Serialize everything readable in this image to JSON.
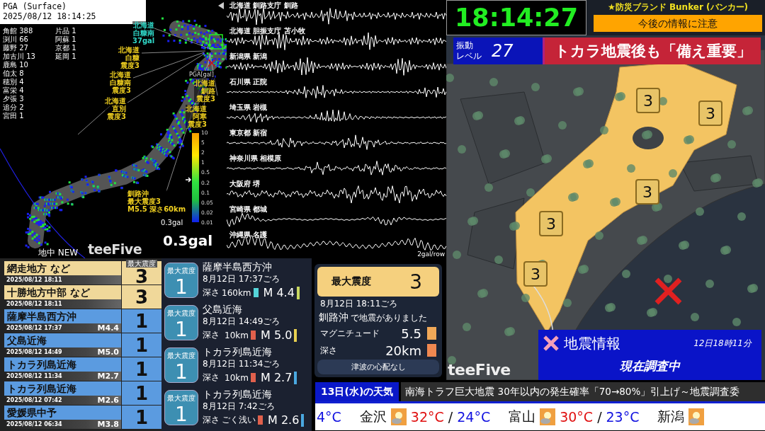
{
  "pga_map": {
    "title": "PGA (Surface)",
    "timestamp": "2025/08/12 18:14:25",
    "station_counts": [
      {
        "name": "角館",
        "count": "388"
      },
      {
        "name": "渕川",
        "count": "66"
      },
      {
        "name": "藤野",
        "count": "27"
      },
      {
        "name": "加古川",
        "count": "13"
      },
      {
        "name": "鹿島",
        "count": "10"
      },
      {
        "name": "伯太",
        "count": "8"
      },
      {
        "name": "穂別",
        "count": "4"
      },
      {
        "name": "富栄",
        "count": "4"
      },
      {
        "name": "夕張",
        "count": "3"
      },
      {
        "name": "追分",
        "count": "2"
      },
      {
        "name": "宮田",
        "count": "1"
      },
      {
        "name": "片品",
        "count": "1"
      },
      {
        "name": "阿蘇",
        "count": "1"
      },
      {
        "name": "京都",
        "count": "1"
      },
      {
        "name": "延岡",
        "count": "1"
      }
    ],
    "labels": [
      {
        "kind": "gal",
        "lines": [
          "北海道",
          "白糠南",
          "37gal"
        ]
      },
      {
        "kind": "intensity",
        "lines": [
          "北海道",
          "白糠",
          "震度3"
        ]
      },
      {
        "kind": "intensity",
        "lines": [
          "北海道",
          "白糠南",
          "震度3"
        ]
      },
      {
        "kind": "intensity",
        "lines": [
          "北海道",
          "直別",
          "震度3"
        ]
      },
      {
        "kind": "intensity",
        "lines": [
          "北海道",
          "釧路",
          "震度3"
        ]
      },
      {
        "kind": "intensity",
        "lines": [
          "北海道",
          "阿寒",
          "震度3"
        ]
      },
      {
        "kind": "epicenter",
        "lines": [
          "釧路沖",
          "最大震度3",
          "M5.5 深さ60km"
        ]
      }
    ],
    "scale": {
      "title": "PGA[gal]",
      "ticks": [
        "10",
        "5",
        "2",
        "1",
        "0.5",
        "0.2",
        "0.1",
        "0.05",
        "0.02",
        "0.01"
      ]
    },
    "current_small": "0.3gal",
    "current_large": "0.3gal",
    "sensor_label": "地中 NEW",
    "logo": "teeFive"
  },
  "waveforms": {
    "stations": [
      "北海道 釧路支庁 釧路",
      "北海道 胆振支庁 苫小牧",
      "新潟県 新潟",
      "石川県 正院",
      "埼玉県 岩槻",
      "東京都 新宿",
      "神奈川県 相模原",
      "大阪府 堺",
      "宮崎県 都城",
      "沖縄県 名護"
    ],
    "scale_label": "2gal/row"
  },
  "recent_list": {
    "intensity_header": "最大震度",
    "rows": [
      {
        "kind": "area",
        "region": "網走地方 など",
        "datetime": "2025/08/12 18:11",
        "intensity": "3"
      },
      {
        "kind": "area",
        "region": "十勝地方中部 など",
        "datetime": "2025/08/12 18:11",
        "intensity": "3"
      },
      {
        "kind": "epicenter",
        "region": "薩摩半島西方沖",
        "datetime": "2025/08/12 17:37",
        "magnitude": "M4.4",
        "intensity": "1"
      },
      {
        "kind": "epicenter",
        "region": "父島近海",
        "datetime": "2025/08/12 14:49",
        "magnitude": "M5.0",
        "intensity": "1"
      },
      {
        "kind": "epicenter",
        "region": "トカラ列島近海",
        "datetime": "2025/08/12 11:34",
        "magnitude": "M2.7",
        "intensity": "1"
      },
      {
        "kind": "epicenter",
        "region": "トカラ列島近海",
        "datetime": "2025/08/12 07:42",
        "magnitude": "M2.6",
        "intensity": "1"
      },
      {
        "kind": "epicenter",
        "region": "愛媛県中予",
        "datetime": "2025/08/12 06:34",
        "magnitude": "M3.8",
        "intensity": "1"
      }
    ]
  },
  "quake_cards": [
    {
      "badge": "最大震度",
      "intensity": "1",
      "place": "薩摩半島西方沖",
      "time": "8月12日 17:37ごろ",
      "depth_label": "深さ",
      "depth": {
        "text": "160km",
        "color": "#55d4d8"
      },
      "magnitude": {
        "text": "M 4.4",
        "color": "#c8d860"
      }
    },
    {
      "badge": "最大震度",
      "intensity": "1",
      "place": "父島近海",
      "time": "8月12日 14:49ごろ",
      "depth_label": "深さ",
      "depth": {
        "text": "10km",
        "color": "#e0604c"
      },
      "magnitude": {
        "text": "M 5.0",
        "color": "#e8d050"
      }
    },
    {
      "badge": "最大震度",
      "intensity": "1",
      "place": "トカラ列島近海",
      "time": "8月12日 11:34ごろ",
      "depth_label": "深さ",
      "depth": {
        "text": "10km",
        "color": "#e0604c"
      },
      "magnitude": {
        "text": "M 2.7",
        "color": "#4aa8e0"
      }
    },
    {
      "badge": "最大震度",
      "intensity": "1",
      "place": "トカラ列島近海",
      "time": "8月12日 7:42ごろ",
      "depth_label": "深さ",
      "depth": {
        "text": "ごく浅い",
        "color": "#e0604c"
      },
      "magnitude": {
        "text": "M 2.6",
        "color": "#4aa8e0"
      }
    }
  ],
  "summary": {
    "label": "最大震度",
    "intensity": "3",
    "time": "8月12日 18:11ごろ",
    "place": "釧路沖",
    "place_suffix": "で地震がありました",
    "rows": [
      {
        "label": "マグニチュード",
        "value": "5.5",
        "color": "#f0a858"
      },
      {
        "label": "深さ",
        "value": "20km",
        "color": "#f08850"
      }
    ],
    "tsunami": "津波の心配なし"
  },
  "clock": "18:14:27",
  "sponsor": "★防災ブランド Bunker (バンカー)",
  "alert": "今後の情報に注意",
  "vibration": {
    "label_lines": [
      "振動",
      "レベル"
    ],
    "value": "27"
  },
  "headline": "トカラ地震後も「備え重要」",
  "intensity_map": {
    "markers": [
      "3",
      "3",
      "3",
      "3",
      "3"
    ],
    "logo": "teeFive"
  },
  "info_box": {
    "title": "地震情報",
    "time": "12日18時11分",
    "status": "現在調査中"
  },
  "weather": {
    "title": "13日(水)の天気",
    "ticker": "南海トラフ巨大地震 30年以内の発生確率「70→80%」引上げ～地震調査委",
    "items": [
      {
        "low": "4°C"
      },
      {
        "city": "金沢",
        "high": "32°C",
        "separator": "/",
        "low": "24°C"
      },
      {
        "city": "富山",
        "high": "30°C",
        "separator": "/",
        "low": "23°C"
      },
      {
        "city": "新潟"
      }
    ]
  }
}
